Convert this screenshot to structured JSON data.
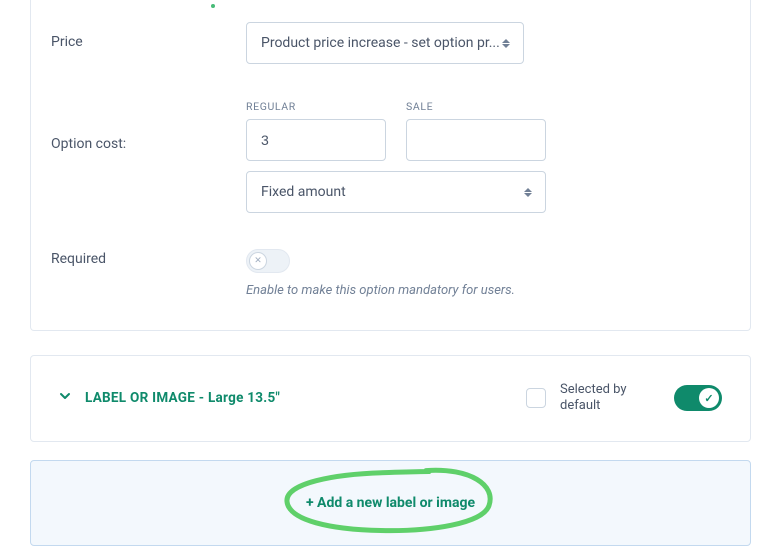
{
  "form": {
    "price": {
      "label": "Price",
      "select_value": "Product price increase - set option pr..."
    },
    "option_cost": {
      "label": "Option cost:",
      "regular_label": "REGULAR",
      "sale_label": "SALE",
      "regular_value": "3",
      "sale_value": "",
      "mode_select": "Fixed amount"
    },
    "required": {
      "label": "Required",
      "enabled": false,
      "help": "Enable to make this option mandatory for users."
    }
  },
  "accordion": {
    "prefix": "LABEL OR IMAGE",
    "suffix": " - Large 13.5\"",
    "selected_by_default_label": "Selected by default",
    "selected_by_default_checked": false,
    "row_enabled": true
  },
  "add": {
    "label": "+ Add a new label or image"
  }
}
